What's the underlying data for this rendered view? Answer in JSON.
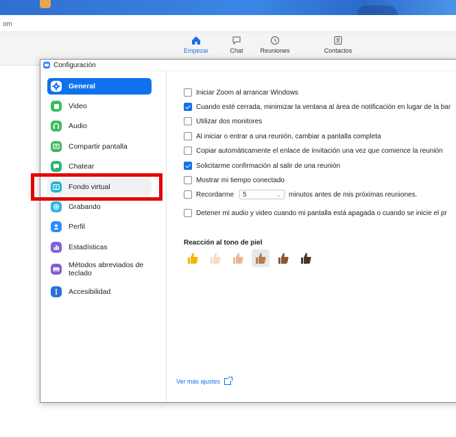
{
  "app_title": "om",
  "header_nav": [
    {
      "label": "Empezar",
      "icon": "home-icon",
      "active": true
    },
    {
      "label": "Chat",
      "icon": "chat-icon",
      "active": false
    },
    {
      "label": "Reuniones",
      "icon": "clock-icon",
      "active": false
    },
    {
      "label": "Contactos",
      "icon": "contacts-icon",
      "active": false
    }
  ],
  "dialog": {
    "title": "Configuración"
  },
  "sidebar": {
    "items": [
      {
        "label": "General",
        "icon": "gear-icon",
        "color": "#0e72ed",
        "selected": true
      },
      {
        "label": "Video",
        "icon": "video-icon",
        "color": "#3ebd60"
      },
      {
        "label": "Audio",
        "icon": "headphones-icon",
        "color": "#3ebd60"
      },
      {
        "label": "Compartir pantalla",
        "icon": "share-screen-icon",
        "color": "#3ebd60"
      },
      {
        "label": "Chatear",
        "icon": "chat-icon",
        "color": "#2bb673"
      },
      {
        "label": "Fondo virtual",
        "icon": "virtual-background-icon",
        "color": "#23b5d3",
        "hover": true
      },
      {
        "label": "Grabando",
        "icon": "record-icon",
        "color": "#2fb6e6"
      },
      {
        "label": "Perfil",
        "icon": "profile-icon",
        "color": "#2d8cff"
      },
      {
        "label": "Estadísticas",
        "icon": "statistics-icon",
        "color": "#7f60d8"
      },
      {
        "label": "Métodos abreviados de teclado",
        "icon": "keyboard-icon",
        "color": "#7f60d8"
      },
      {
        "label": "Accesibilidad",
        "icon": "accessibility-icon",
        "color": "#2d6fd8"
      }
    ]
  },
  "general": {
    "options": [
      {
        "label": "Iniciar Zoom al arrancar Windows",
        "checked": false
      },
      {
        "label": "Cuando esté cerrada, minimizar la ventana al área de notificación en lugar de la bar",
        "checked": true
      },
      {
        "label": "Utilizar dos monitores",
        "checked": false
      },
      {
        "label": "Al iniciar o entrar a una reunión, cambiar a pantalla completa",
        "checked": false
      },
      {
        "label": "Copiar automáticamente el enlace de invitación una vez que comience la reunión",
        "checked": false
      },
      {
        "label": "Solicitarme confirmación al salir de una reunión",
        "checked": true
      },
      {
        "label": "Mostrar mi tiempo conectado",
        "checked": false
      }
    ],
    "reminder": {
      "label": "Recordarme",
      "value": "5",
      "suffix": "minutos antes de mis próximas reuniones.",
      "checked": false
    },
    "stop_av": {
      "label": "Detener mi audio y video cuando mi pantalla está apagada o cuando se inicie el pr",
      "checked": false
    },
    "skin_tone_title": "Reacción al tono de piel",
    "skin_tones": [
      "#f2b500",
      "#f5dcc4",
      "#e8b896",
      "#b57a52",
      "#8a5533",
      "#4f3325"
    ],
    "skin_selected": 3,
    "more_settings": "Ver más ajustes"
  },
  "highlight_color": "#e30000"
}
